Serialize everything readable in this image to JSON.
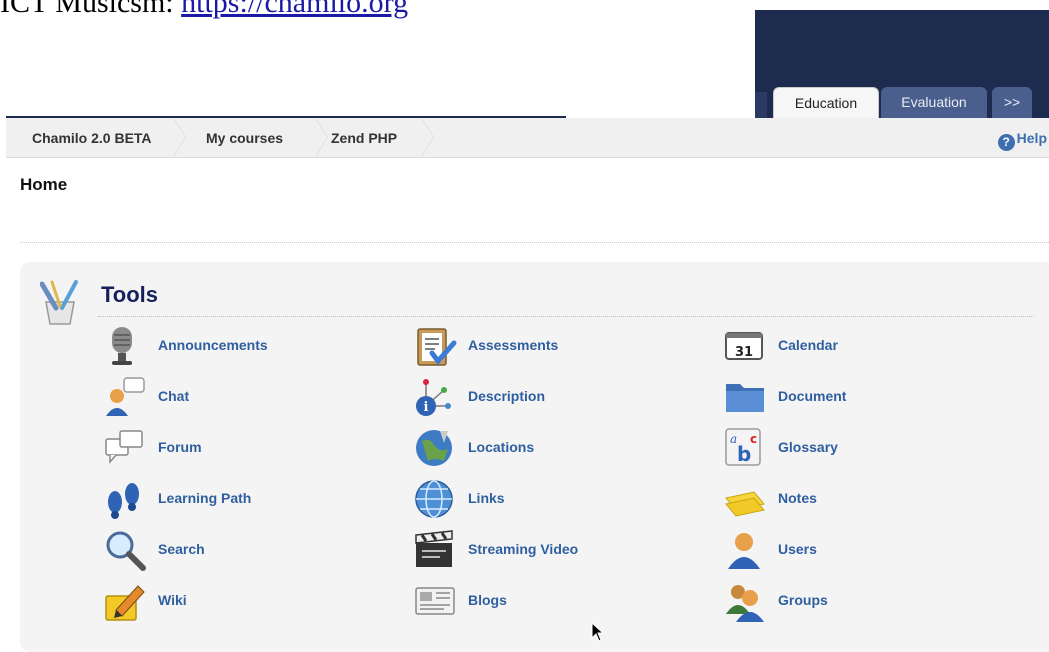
{
  "caption": {
    "prefix": "ICT Musicsm:",
    "link": "https://chamilo.org"
  },
  "tabs": [
    {
      "label": "Education",
      "active": true
    },
    {
      "label": "Evaluation",
      "active": false
    },
    {
      "label": ">>",
      "active": false
    }
  ],
  "breadcrumb": [
    "Chamilo 2.0 BETA",
    "My courses",
    "Zend PHP"
  ],
  "help_label": "Help",
  "page_title": "Home",
  "tools": {
    "title": "Tools",
    "items": [
      {
        "label": "Announcements",
        "icon": "microphone-icon"
      },
      {
        "label": "Assessments",
        "icon": "clipboard-check-icon"
      },
      {
        "label": "Calendar",
        "icon": "calendar-icon"
      },
      {
        "label": "Chat",
        "icon": "chat-user-icon"
      },
      {
        "label": "Description",
        "icon": "info-graph-icon"
      },
      {
        "label": "Document",
        "icon": "folder-icon"
      },
      {
        "label": "Forum",
        "icon": "forum-bubbles-icon"
      },
      {
        "label": "Locations",
        "icon": "globe-pin-icon"
      },
      {
        "label": "Glossary",
        "icon": "glossary-abc-icon"
      },
      {
        "label": "Learning Path",
        "icon": "footprints-icon"
      },
      {
        "label": "Links",
        "icon": "globe-icon"
      },
      {
        "label": "Notes",
        "icon": "notes-icon"
      },
      {
        "label": "Search",
        "icon": "magnifier-icon"
      },
      {
        "label": "Streaming Video",
        "icon": "clapperboard-icon"
      },
      {
        "label": "Users",
        "icon": "user-icon"
      },
      {
        "label": "Wiki",
        "icon": "wiki-pencil-icon"
      },
      {
        "label": "Blogs",
        "icon": "newspaper-icon"
      },
      {
        "label": "Groups",
        "icon": "group-icon"
      }
    ]
  },
  "colors": {
    "header_navy": "#1d2b4f",
    "tab_blue": "#4a5f8e",
    "link_blue": "#2f5f9f",
    "tools_title": "#16205a"
  }
}
